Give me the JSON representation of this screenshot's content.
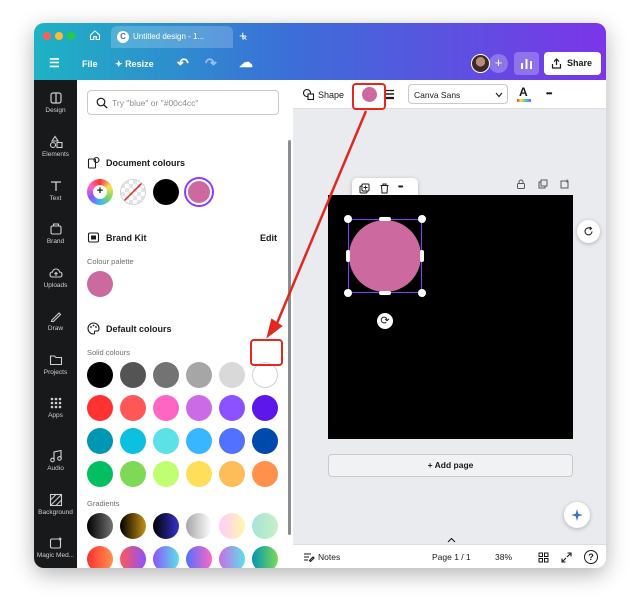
{
  "browser": {
    "tab_title": "Untitled design - 1...",
    "tab_logo": "C",
    "close_glyph": "×",
    "new_tab_glyph": "+",
    "icons": [
      "home-icon",
      "canva-logo-icon"
    ]
  },
  "toolbar": {
    "file_label": "File",
    "resize_label": "Resize",
    "resize_glyph": "✦",
    "menu_glyph": "☰",
    "undo_glyph": "↶",
    "redo_glyph": "↷",
    "cloud_glyph": "☁",
    "add_glyph": "+",
    "share_label": "Share"
  },
  "rail": {
    "items": [
      {
        "label": "Design",
        "icon": "design-icon"
      },
      {
        "label": "Elements",
        "icon": "elements-icon"
      },
      {
        "label": "Text",
        "icon": "text-icon"
      },
      {
        "label": "Brand",
        "icon": "brand-icon"
      },
      {
        "label": "Uploads",
        "icon": "uploads-icon"
      },
      {
        "label": "Draw",
        "icon": "draw-icon"
      },
      {
        "label": "Projects",
        "icon": "projects-icon"
      },
      {
        "label": "Apps",
        "icon": "apps-icon"
      },
      {
        "label": "Audio",
        "icon": "audio-icon"
      },
      {
        "label": "Background",
        "icon": "background-icon"
      },
      {
        "label": "Magic Med...",
        "icon": "magic-media-icon"
      }
    ]
  },
  "panel": {
    "search_placeholder": "Try \"blue\" or \"#00c4cc\"",
    "document_colours_title": "Document colours",
    "document_colours": [
      "#000000",
      "#cc6a9f"
    ],
    "brand_kit_title": "Brand Kit",
    "brand_kit_edit": "Edit",
    "colour_palette_label": "Colour palette",
    "brand_palette": [
      "#cc6a9f"
    ],
    "default_colours_title": "Default colours",
    "solid_colours_label": "Solid colours",
    "solid_colours": [
      [
        "#000000",
        "#545454",
        "#737373",
        "#a6a6a6",
        "#d9d9d9",
        "#ffffff"
      ],
      [
        "#ff3131",
        "#ff5757",
        "#ff66c4",
        "#cb6ce6",
        "#8c52ff",
        "#5e17eb"
      ],
      [
        "#0097b2",
        "#0cc0df",
        "#5ce1e6",
        "#38b6ff",
        "#5271ff",
        "#004aad"
      ],
      [
        "#00bf63",
        "#7ed957",
        "#c1ff72",
        "#ffde59",
        "#ffbd59",
        "#ff914d"
      ]
    ],
    "gradients_label": "Gradients",
    "gradients": [
      [
        "linear-gradient(90deg,#000000,#737373)",
        "linear-gradient(90deg,#000000,#c89116)",
        "linear-gradient(90deg,#000000,#3533cd)",
        "linear-gradient(90deg,#a6a6a6,#ffffff)",
        "linear-gradient(90deg,#ffcbfd,#fff7ad)",
        "linear-gradient(90deg,#a6e3d8,#c8f0c6)"
      ],
      [
        "linear-gradient(90deg,#ff3131,#ff914d)",
        "linear-gradient(90deg,#ff5757,#8c52ff)",
        "linear-gradient(90deg,#8c52ff,#5ce1e6)",
        "linear-gradient(90deg,#5170ff,#ff66c4)",
        "linear-gradient(90deg,#cb6ce6,#5ce1e6)",
        "linear-gradient(90deg,#0097b2,#7ed957)"
      ]
    ]
  },
  "editor": {
    "shape_label": "Shape",
    "font_name": "Canva Sans",
    "font_color_letter": "A",
    "more_glyph": "•••",
    "selected_color": "#cc6a9f",
    "circle_color": "#cc6a9f",
    "canvas_color": "#000000",
    "add_page_label": "+ Add page",
    "notes_label": "Notes",
    "page_indicator": "Page 1 / 1",
    "zoom": "38%",
    "help_glyph": "?",
    "rotate_glyph": "⟳"
  },
  "annotations": {
    "highlight_color": "#e3281f",
    "arrow": "from selected colour swatch to the white solid colour"
  }
}
